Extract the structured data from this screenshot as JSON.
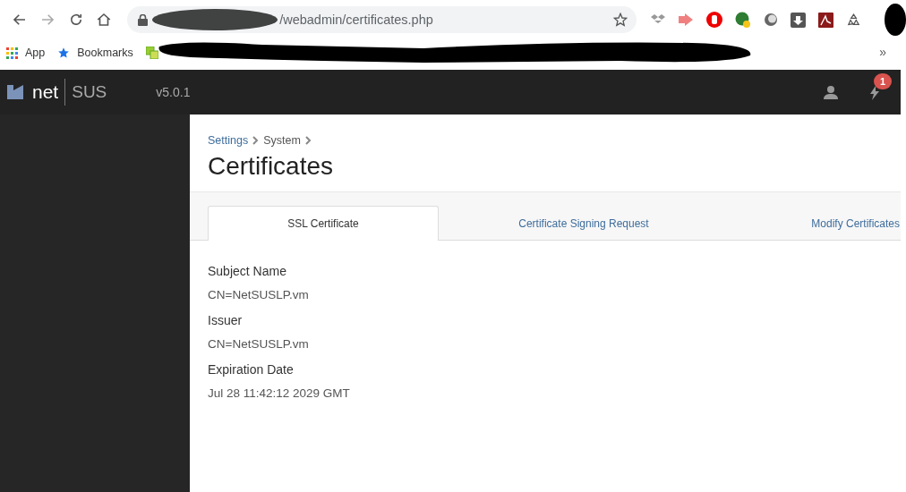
{
  "browser": {
    "address_bar": {
      "url": "/webadmin/certificates.php"
    },
    "bookmarks": [
      {
        "kind": "apps",
        "label": "App"
      },
      {
        "kind": "star",
        "label": "Bookmarks"
      }
    ],
    "bookmarks_overflow": "»"
  },
  "app_header": {
    "logo": {
      "left": "net",
      "right": "SUS"
    },
    "version": "v5.0.1",
    "notifications": {
      "count": "1"
    }
  },
  "breadcrumb": [
    {
      "kind": "link",
      "label": "Settings"
    },
    {
      "kind": "text",
      "label": "System"
    }
  ],
  "title": "Certificates",
  "tabs": [
    {
      "label": "SSL Certificate",
      "selected": true
    },
    {
      "label": "Certificate Signing Request",
      "selected": false
    },
    {
      "label": "Modify Certificates",
      "selected": false
    }
  ],
  "fields": [
    {
      "label": "Subject Name",
      "value": "CN=NetSUSLP.vm"
    },
    {
      "label": "Issuer",
      "value": "CN=NetSUSLP.vm"
    },
    {
      "label": "Expiration Date",
      "value": "Jul 28 11:42:12 2029 GMT"
    }
  ]
}
